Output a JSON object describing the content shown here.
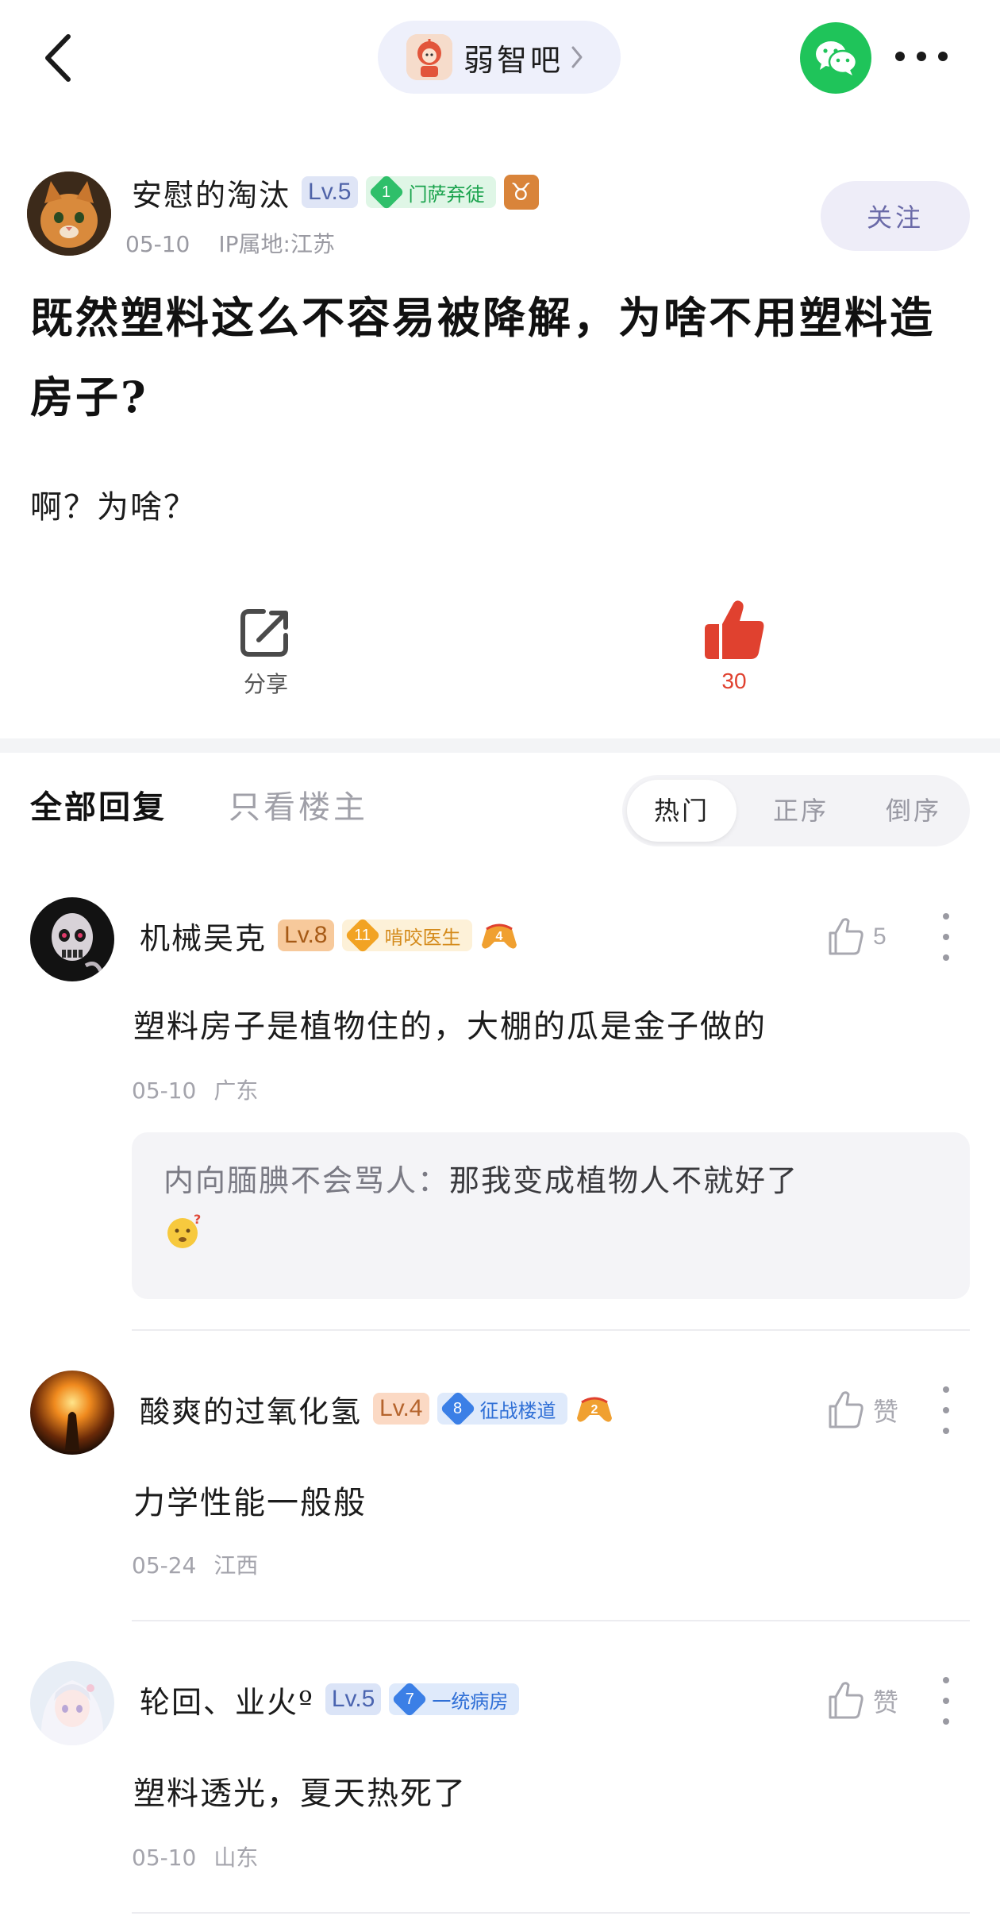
{
  "header": {
    "forum_name": "弱智吧"
  },
  "post": {
    "author": "安慰的淘汰",
    "level": "Lv.5",
    "title_badge_num": "1",
    "title_badge": "门萨弃徒",
    "zodiac_glyph": "♉",
    "date": "05-10",
    "ip_location": "IP属地:江苏",
    "follow_label": "关注",
    "title": "既然塑料这么不容易被降解，为啥不用塑料造房子?",
    "body": "啊？为啥？",
    "share_label": "分享",
    "like_count": "30"
  },
  "replies_bar": {
    "tab_all": "全部回复",
    "tab_op_only": "只看楼主",
    "sort_options": [
      "热门",
      "正序",
      "倒序"
    ],
    "active_sort": "热门"
  },
  "comments": [
    {
      "author": "机械吴克",
      "level": "Lv.8",
      "badge_num": "11",
      "badge": "啃咬医生",
      "extra_num": "4",
      "likes": "5",
      "text": "塑料房子是植物住的，大棚的瓜是金子做的",
      "date": "05-10",
      "location": "广东",
      "sub_reply": {
        "author": "内向腼腆不会骂人：",
        "text": "那我变成植物人不就好了"
      }
    },
    {
      "author": "酸爽的过氧化氢",
      "level": "Lv.4",
      "badge_num": "8",
      "badge": "征战楼道",
      "extra_num": "2",
      "likes_label": "赞",
      "text": "力学性能一般般",
      "date": "05-24",
      "location": "江西"
    },
    {
      "author": "轮回、业火º",
      "level": "Lv.5",
      "badge_num": "7",
      "badge": "一统病房",
      "likes_label": "赞",
      "text": "塑料透光，夏天热死了",
      "date": "05-10",
      "location": "山东"
    }
  ],
  "colors": {
    "accent_red": "#e0412f",
    "wechat_green": "#1fc45a",
    "follow_bg": "#eeedf8"
  }
}
